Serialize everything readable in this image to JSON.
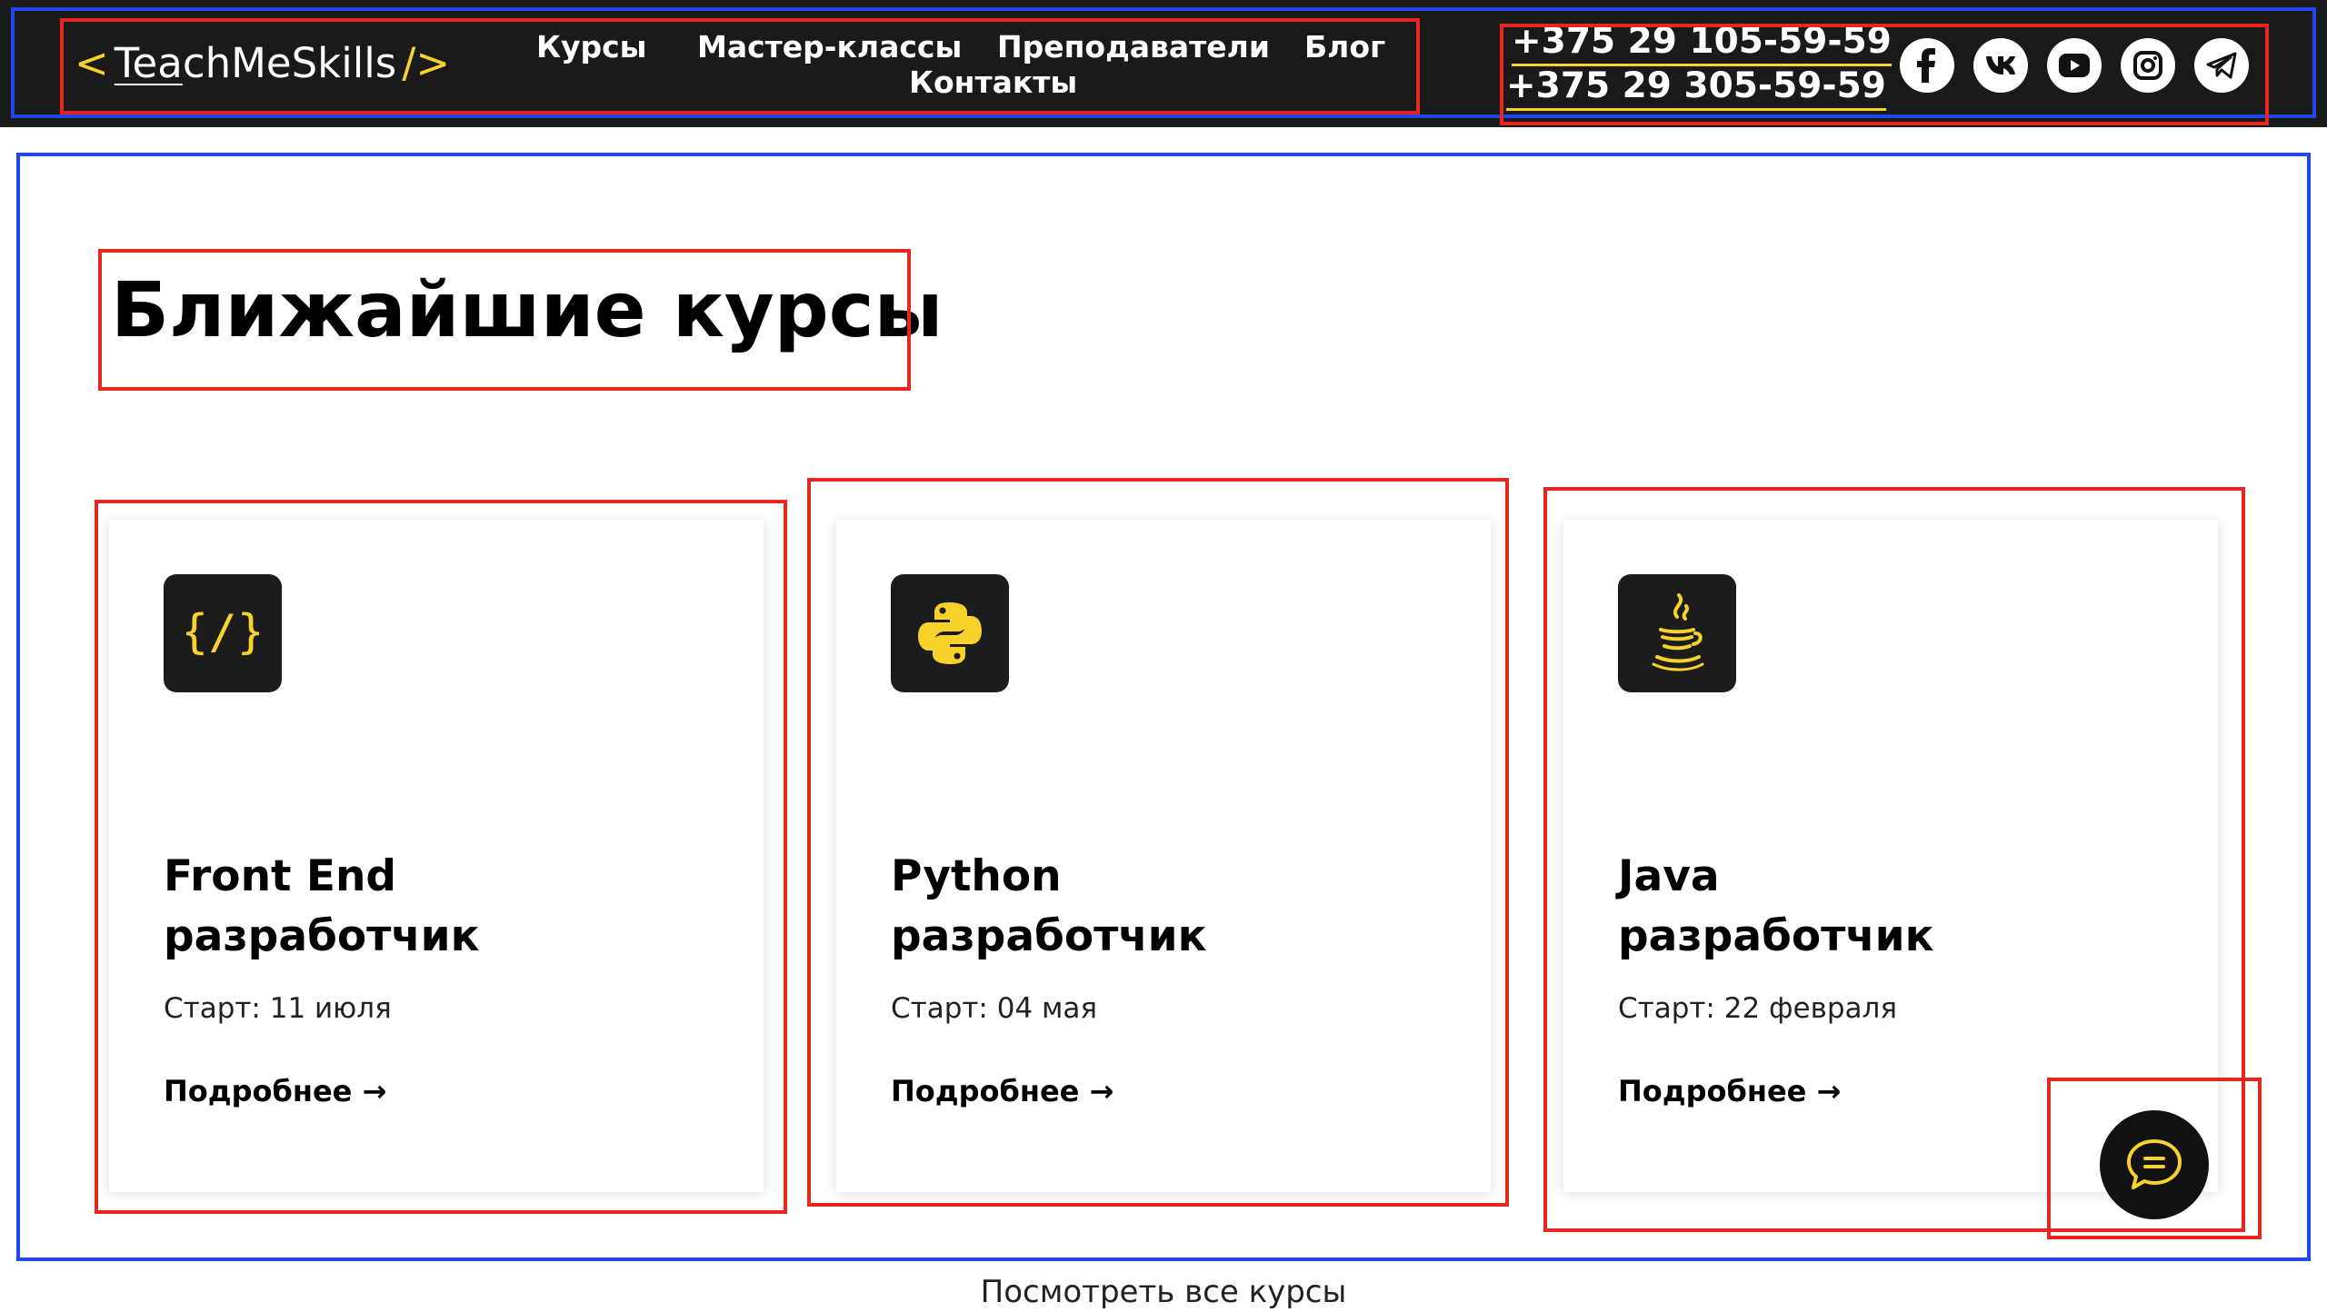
{
  "header": {
    "logo": {
      "left": "<",
      "name_part1": "Tea",
      "name_part2": "chMeSkills",
      "right": "/>"
    },
    "nav": [
      "Курсы",
      "Мастер-классы",
      "Преподаватели",
      "Блог",
      "Контакты"
    ],
    "phones": [
      "+375 29 105-59-59",
      "+375 29 305-59-59"
    ],
    "socials": [
      "facebook-icon",
      "vk-icon",
      "youtube-icon",
      "instagram-icon",
      "telegram-icon"
    ]
  },
  "main": {
    "title": "Ближайшие курсы",
    "courses": [
      {
        "title_line1": "Front End",
        "title_line2": "разработчик",
        "start": "Старт: 11 июля",
        "more": "Подробнее →",
        "icon": "code-icon"
      },
      {
        "title_line1": "Python",
        "title_line2": "разработчик",
        "start": "Старт: 04 мая",
        "more": "Подробнее →",
        "icon": "python-icon"
      },
      {
        "title_line1": "Java",
        "title_line2": "разработчик",
        "start": "Старт: 22 февраля",
        "more": "Подробнее →",
        "icon": "java-icon"
      }
    ],
    "view_all": "Посмотреть все курсы"
  },
  "colors": {
    "accent": "#f7d22a",
    "header_bg": "#1a1a1a",
    "annotation_blue": "#2247f0",
    "annotation_red": "#e8261e"
  }
}
